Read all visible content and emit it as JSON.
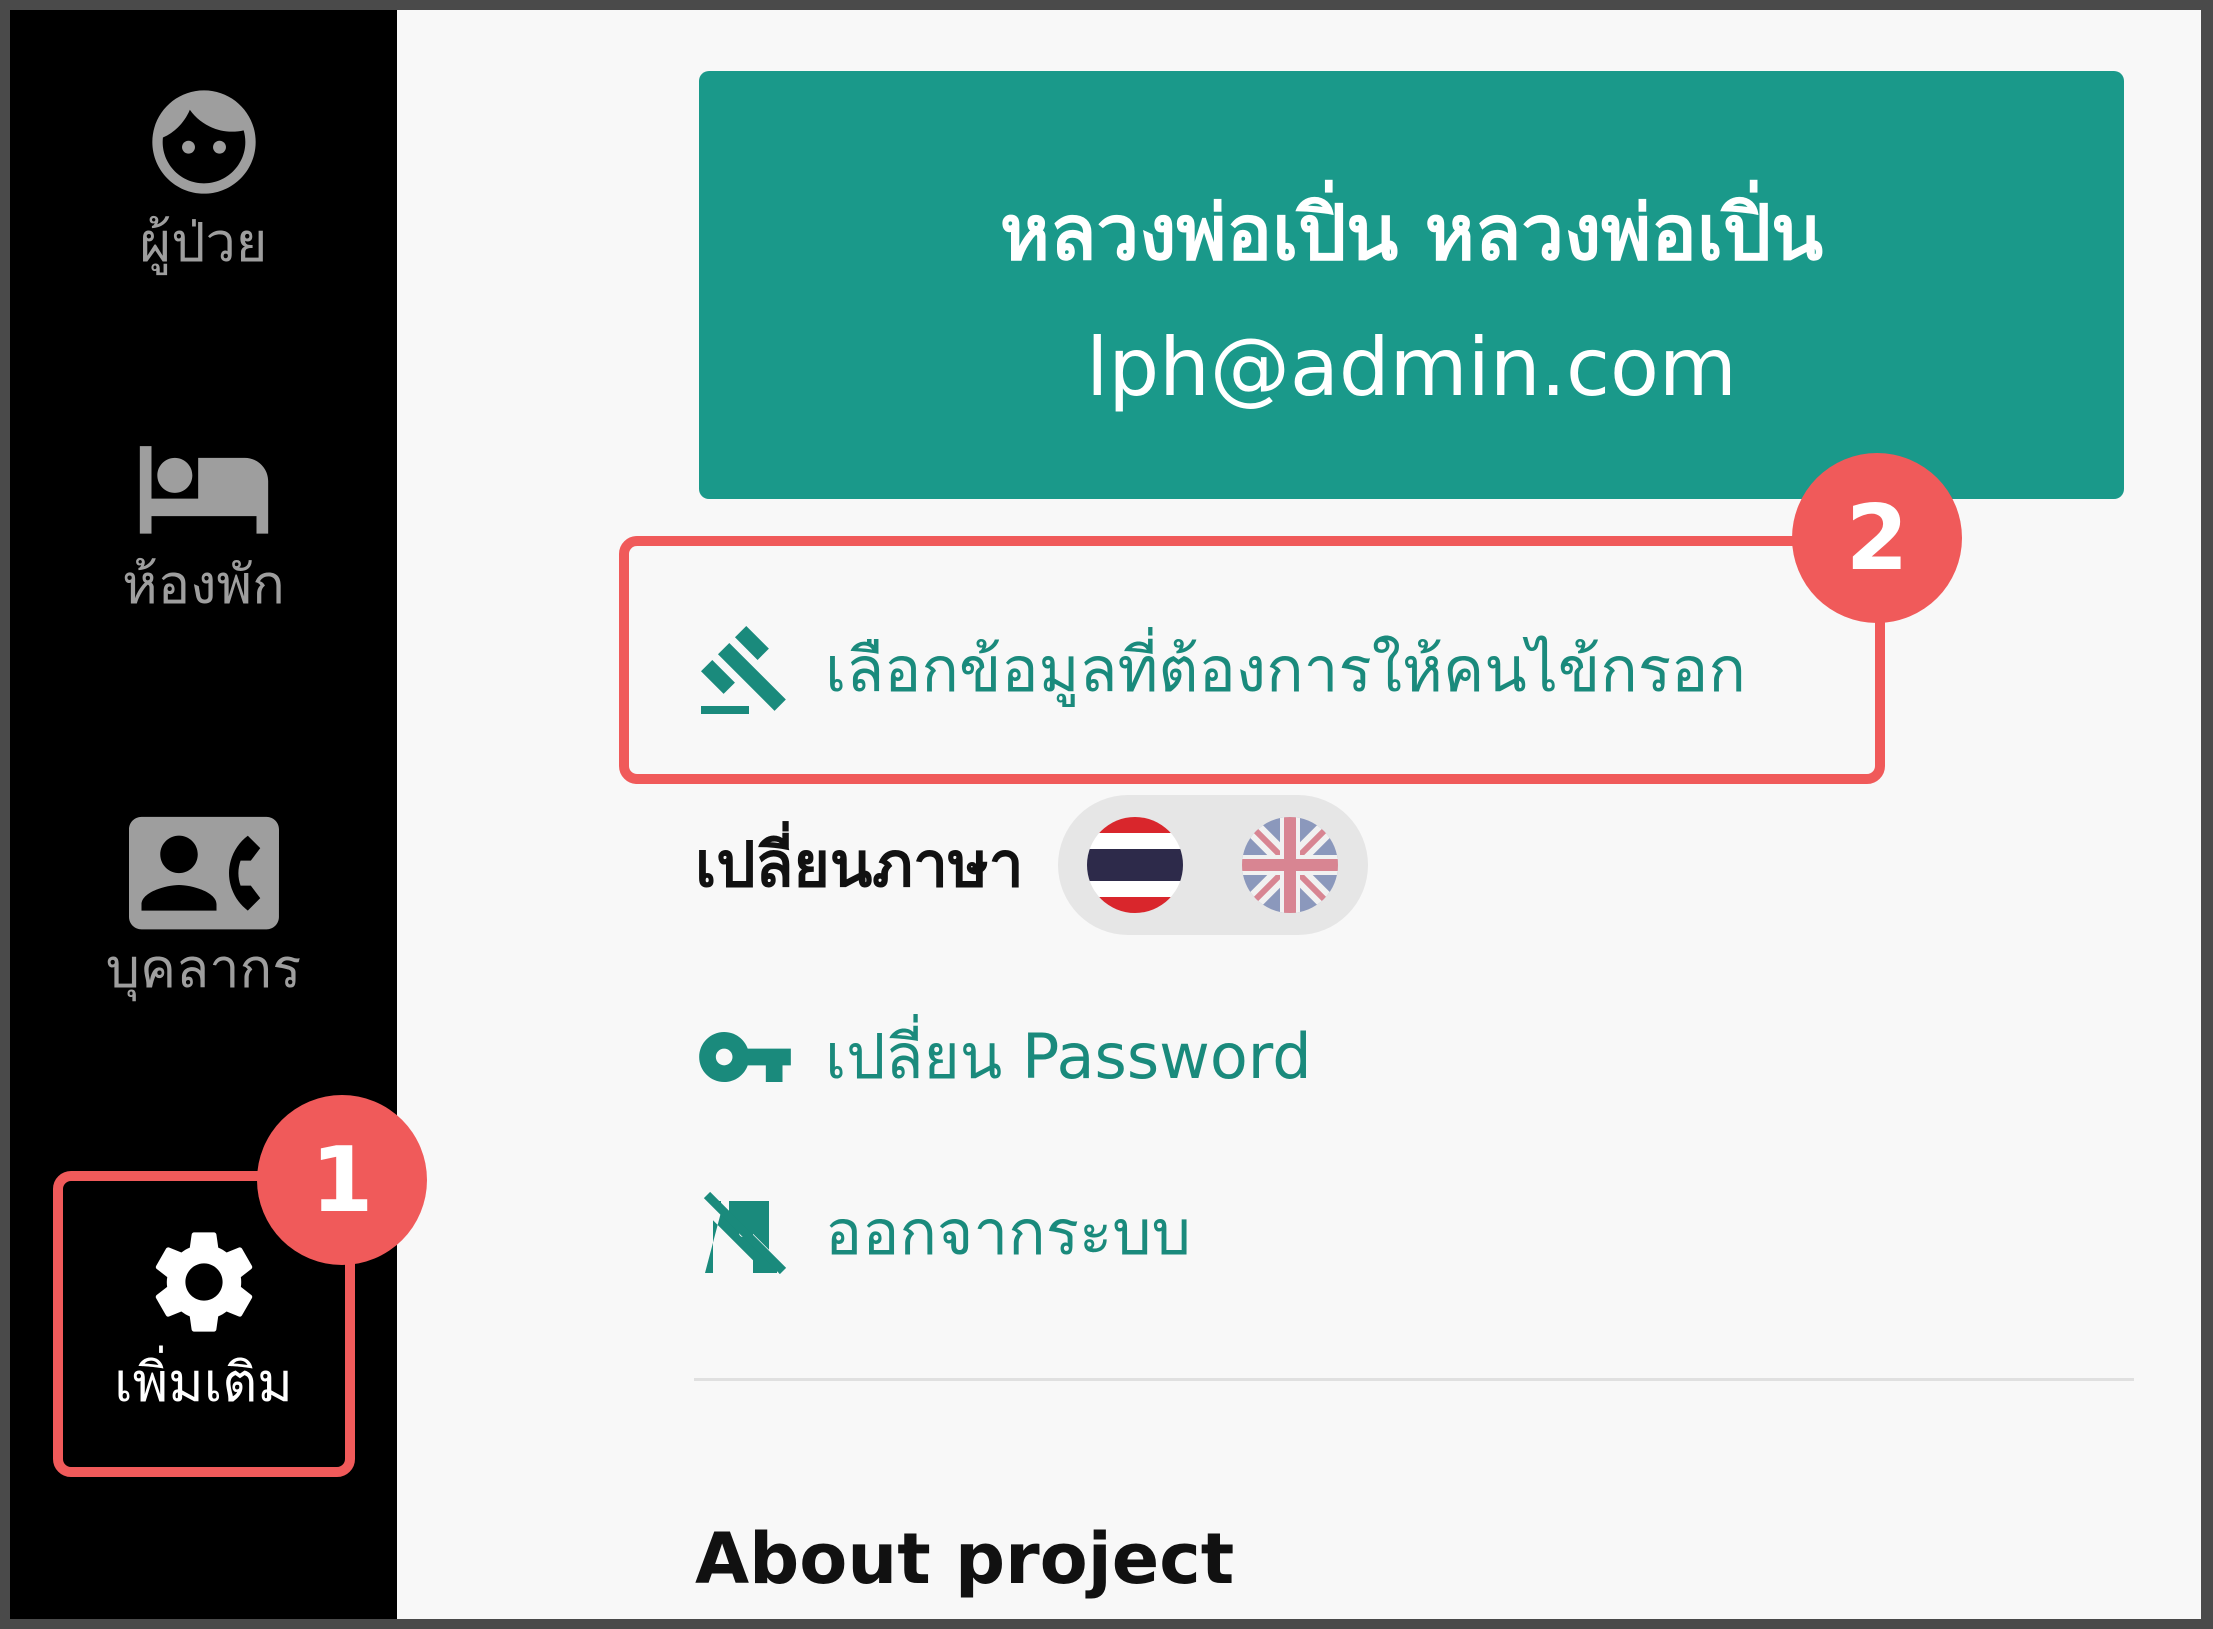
{
  "sidebar": {
    "items": [
      {
        "label": "ผู้ป่วย",
        "icon": "face-icon"
      },
      {
        "label": "ห้องพัก",
        "icon": "bed-icon"
      },
      {
        "label": "บุคลากร",
        "icon": "contact-phone-icon"
      },
      {
        "label": "เพิ่มเติม",
        "icon": "gear-icon",
        "active": true
      }
    ]
  },
  "profile": {
    "name": "หลวงพ่อเปิ่น หลวงพ่อเปิ่น",
    "email": "lph@admin.com"
  },
  "menu": {
    "select_fields": {
      "label": "เลือกข้อมูลที่ต้องการให้คนไข้กรอก",
      "icon": "gavel-icon"
    },
    "change_language": {
      "label": "เปลี่ยนภาษา",
      "options": [
        "thai-flag-icon",
        "uk-flag-icon"
      ],
      "selected": "thai-flag-icon"
    },
    "change_password": {
      "label": "เปลี่ยน Password",
      "icon": "key-icon"
    },
    "logout": {
      "label": "ออกจากระบบ",
      "icon": "no-entry-door-icon"
    }
  },
  "about": {
    "title": "About project"
  },
  "annotations": {
    "badge_1": "1",
    "badge_2": "2"
  },
  "colors": {
    "accent": "#1a998a",
    "annotation": "#f05a5a",
    "sidebar_bg": "#000000"
  }
}
